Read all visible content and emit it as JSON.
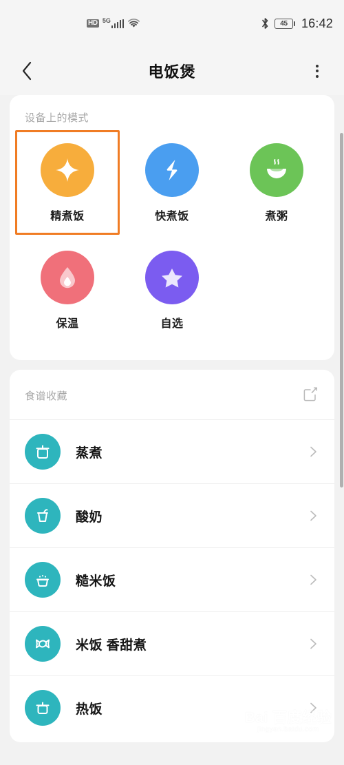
{
  "status_bar": {
    "hd_label": "HD",
    "network_label": "5G",
    "signal_icon": "signal-bars-icon",
    "wifi_icon": "wifi-icon",
    "bluetooth_icon": "bluetooth-icon",
    "battery_level": "45",
    "time": "16:42"
  },
  "appbar": {
    "back_icon": "chevron-left-icon",
    "title": "电饭煲",
    "more_icon": "more-vertical-icon"
  },
  "modes_card": {
    "section_title": "设备上的模式",
    "modes": [
      {
        "label": "精煮饭",
        "icon": "sparkle-icon",
        "color": "#f7ad3c",
        "selected": true
      },
      {
        "label": "快煮饭",
        "icon": "lightning-icon",
        "color": "#4a9ef0",
        "selected": false
      },
      {
        "label": "煮粥",
        "icon": "steaming-bowl-icon",
        "color": "#6cc койка",
        "selected": false
      },
      {
        "label": "保温",
        "icon": "droplet-icon",
        "color": "#f0707a",
        "selected": false
      },
      {
        "label": "自选",
        "icon": "star-icon",
        "color": "#7b5cf0",
        "selected": false
      }
    ],
    "selection_highlight_color": "#f07c24"
  },
  "recipes_card": {
    "section_title": "食谱收藏",
    "edit_icon": "edit-square-icon",
    "icon_color": "#2eb5bd",
    "chevron_icon": "chevron-right-icon",
    "items": [
      {
        "label": "蒸煮",
        "icon": "steamer-pot-icon"
      },
      {
        "label": "酸奶",
        "icon": "yogurt-cup-icon"
      },
      {
        "label": "糙米饭",
        "icon": "rice-bowl-icon"
      },
      {
        "label": "米饭 香甜煮",
        "icon": "candy-icon"
      },
      {
        "label": "热饭",
        "icon": "rice-cooker-icon"
      }
    ]
  },
  "watermark": {
    "main": "Bai 百度经验",
    "sub": "jingyan.baidu.com"
  }
}
